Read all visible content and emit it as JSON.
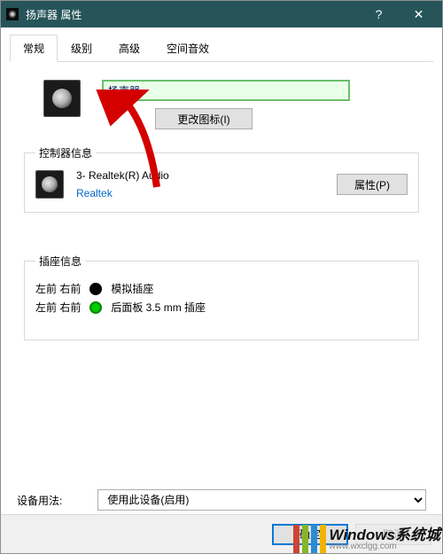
{
  "window": {
    "title": "扬声器 属性"
  },
  "tabs": {
    "general": "常规",
    "levels": "级别",
    "advanced": "高级",
    "spatial": "空间音效"
  },
  "device": {
    "name_value": "扬声器",
    "change_icon_label": "更改图标(I)"
  },
  "controller": {
    "legend": "控制器信息",
    "name": "3- Realtek(R) Audio",
    "vendor": "Realtek",
    "properties_label": "属性(P)"
  },
  "jacks": {
    "legend": "插座信息",
    "rows": [
      {
        "pos": "左前 右前",
        "dot": "black",
        "desc": "模拟插座"
      },
      {
        "pos": "左前 右前",
        "dot": "green",
        "desc": "后面板 3.5 mm 插座"
      }
    ]
  },
  "usage": {
    "label": "设备用法:",
    "selected": "使用此设备(启用)"
  },
  "buttons": {
    "ok": "确定",
    "cancel": "取消"
  },
  "watermark": {
    "brand": "Windows系统城",
    "url": "www.wxclgg.com"
  }
}
